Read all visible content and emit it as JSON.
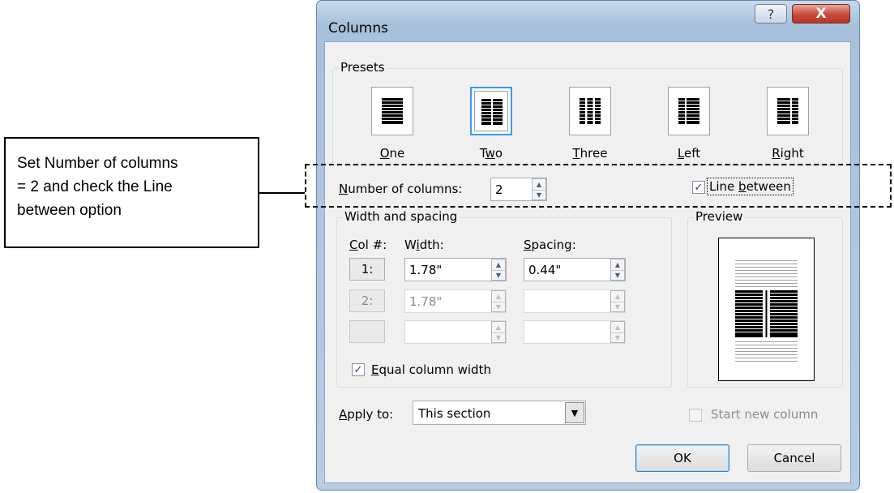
{
  "annotation": {
    "callout_lines": [
      "Set Number of columns",
      "= 2 and check the Line",
      "between option"
    ]
  },
  "dialog": {
    "title": "Columns",
    "help_symbol": "?",
    "close_symbol": "X",
    "presets": {
      "group_title": "Presets",
      "items": [
        {
          "label_parts": [
            "",
            "O",
            "ne"
          ],
          "selected": false
        },
        {
          "label_parts": [
            "T",
            "w",
            "o"
          ],
          "selected": true
        },
        {
          "label_parts": [
            "",
            "T",
            "hree"
          ],
          "selected": false
        },
        {
          "label_parts": [
            "",
            "L",
            "eft"
          ],
          "selected": false
        },
        {
          "label_parts": [
            "",
            "R",
            "ight"
          ],
          "selected": false
        }
      ]
    },
    "number_of_columns": {
      "label_parts": [
        "",
        "N",
        "umber of columns:"
      ],
      "value": "2"
    },
    "line_between": {
      "label_parts": [
        "Line ",
        "b",
        "etween"
      ],
      "checked": true
    },
    "width_spacing": {
      "group_title": "Width and spacing",
      "col_header_parts": [
        "",
        "C",
        "ol #:"
      ],
      "width_header_parts": [
        "W",
        "i",
        "dth:"
      ],
      "spacing_header_parts": [
        "",
        "S",
        "pacing:"
      ],
      "rows": [
        {
          "col": "1:",
          "width": "1.78\"",
          "spacing": "0.44\"",
          "enabled": true
        },
        {
          "col": "2:",
          "width": "1.78\"",
          "spacing": "",
          "enabled": false
        },
        {
          "col": "",
          "width": "",
          "spacing": "",
          "enabled": false
        }
      ]
    },
    "equal_width": {
      "label_parts": [
        "",
        "E",
        "qual column width"
      ],
      "checked": true
    },
    "preview": {
      "group_title": "Preview"
    },
    "apply_to": {
      "label_parts": [
        "",
        "A",
        "pply to:"
      ],
      "value": "This section"
    },
    "start_new_column": {
      "label": "Start new column",
      "checked": false,
      "enabled": false
    },
    "ok_label": "OK",
    "cancel_label": "Cancel"
  },
  "colors": {
    "selection_blue": "#3399ff",
    "close_red": "#c9493a",
    "checkmark": "#2c4a8a"
  }
}
